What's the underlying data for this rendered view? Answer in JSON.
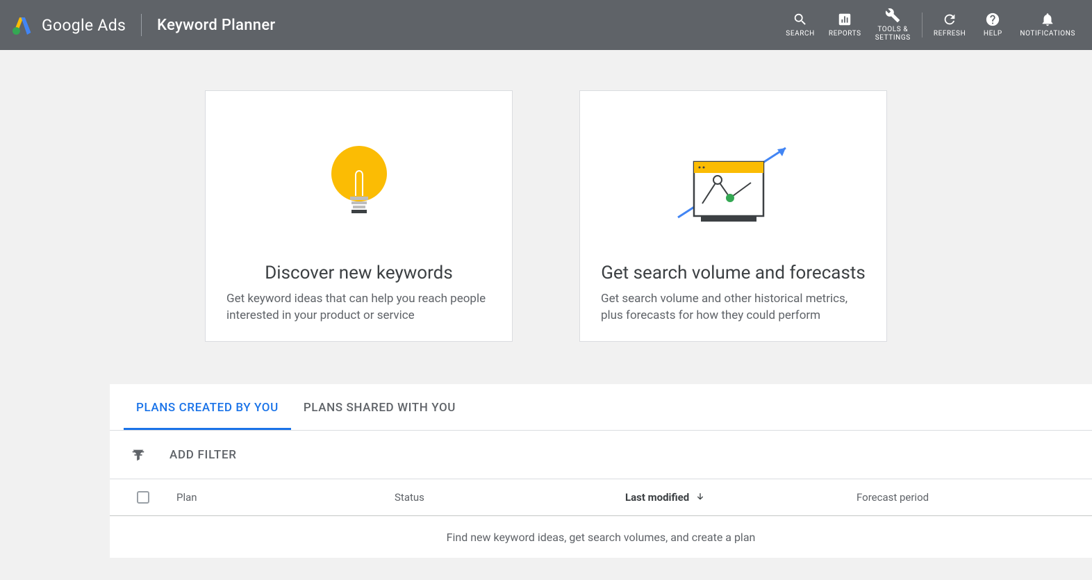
{
  "header": {
    "product_name": "Google Ads",
    "page_name": "Keyword Planner",
    "nav": {
      "search": "SEARCH",
      "reports": "REPORTS",
      "tools": "TOOLS &\nSETTINGS",
      "refresh": "REFRESH",
      "help": "HELP",
      "notifications": "NOTIFICATIONS"
    }
  },
  "cards": {
    "discover": {
      "title": "Discover new keywords",
      "desc": "Get keyword ideas that can help you reach people interested in your product or service"
    },
    "forecast": {
      "title": "Get search volume and forecasts",
      "desc": "Get search volume and other historical metrics, plus forecasts for how they could perform"
    }
  },
  "plans": {
    "tabs": {
      "created": "PLANS CREATED BY YOU",
      "shared": "PLANS SHARED WITH YOU"
    },
    "filter": {
      "add": "ADD FILTER"
    },
    "columns": {
      "plan": "Plan",
      "status": "Status",
      "modified": "Last modified",
      "forecast": "Forecast period"
    },
    "empty": "Find new keyword ideas, get search volumes, and create a plan"
  }
}
